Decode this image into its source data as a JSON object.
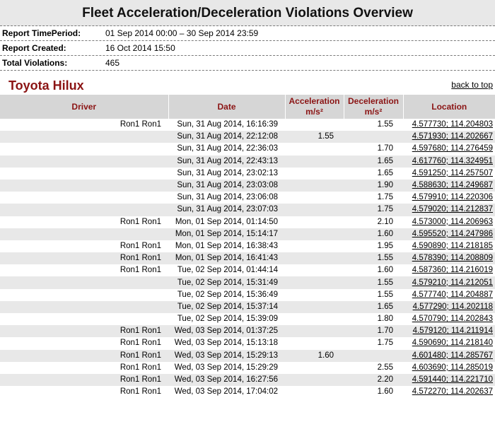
{
  "report": {
    "title": "Fleet Acceleration/Deceleration Violations Overview",
    "info": [
      {
        "label": "Report TimePeriod:",
        "value": "01 Sep 2014 00:00 – 30 Sep 2014 23:59"
      },
      {
        "label": "Report Created:",
        "value": "16 Oct 2014 15:50"
      },
      {
        "label": "Total Violations:",
        "value": "465"
      }
    ]
  },
  "vehicle": {
    "name": "Toyota Hilux",
    "back_to_top": "back to top"
  },
  "table": {
    "headers": {
      "driver": "Driver",
      "date": "Date",
      "acceleration": "Acceleration",
      "acceleration_unit": "m/s²",
      "deceleration": "Deceleration",
      "deceleration_unit": "m/s²",
      "location": "Location"
    },
    "rows": [
      {
        "driver": "Ron1 Ron1",
        "date": "Sun, 31 Aug 2014, 16:16:39",
        "acc": "",
        "dec": "1.55",
        "loc": "4.577730; 114.204803"
      },
      {
        "driver": "",
        "date": "Sun, 31 Aug 2014, 22:12:08",
        "acc": "1.55",
        "dec": "",
        "loc": "4.571930; 114.202667"
      },
      {
        "driver": "",
        "date": "Sun, 31 Aug 2014, 22:36:03",
        "acc": "",
        "dec": "1.70",
        "loc": "4.597680; 114.276459"
      },
      {
        "driver": "",
        "date": "Sun, 31 Aug 2014, 22:43:13",
        "acc": "",
        "dec": "1.65",
        "loc": "4.617760; 114.324951"
      },
      {
        "driver": "",
        "date": "Sun, 31 Aug 2014, 23:02:13",
        "acc": "",
        "dec": "1.65",
        "loc": "4.591250; 114.257507"
      },
      {
        "driver": "",
        "date": "Sun, 31 Aug 2014, 23:03:08",
        "acc": "",
        "dec": "1.90",
        "loc": "4.588630; 114.249687"
      },
      {
        "driver": "",
        "date": "Sun, 31 Aug 2014, 23:06:08",
        "acc": "",
        "dec": "1.75",
        "loc": "4.579910; 114.220306"
      },
      {
        "driver": "",
        "date": "Sun, 31 Aug 2014, 23:07:03",
        "acc": "",
        "dec": "1.75",
        "loc": "4.579020; 114.212837"
      },
      {
        "driver": "Ron1 Ron1",
        "date": "Mon, 01 Sep 2014, 01:14:50",
        "acc": "",
        "dec": "2.10",
        "loc": "4.573000; 114.206963"
      },
      {
        "driver": "",
        "date": "Mon, 01 Sep 2014, 15:14:17",
        "acc": "",
        "dec": "1.60",
        "loc": "4.595520; 114.247986"
      },
      {
        "driver": "Ron1 Ron1",
        "date": "Mon, 01 Sep 2014, 16:38:43",
        "acc": "",
        "dec": "1.95",
        "loc": "4.590890; 114.218185"
      },
      {
        "driver": "Ron1 Ron1",
        "date": "Mon, 01 Sep 2014, 16:41:43",
        "acc": "",
        "dec": "1.55",
        "loc": "4.578390; 114.208809"
      },
      {
        "driver": "Ron1 Ron1",
        "date": "Tue, 02 Sep 2014, 01:44:14",
        "acc": "",
        "dec": "1.60",
        "loc": "4.587360; 114.216019"
      },
      {
        "driver": "",
        "date": "Tue, 02 Sep 2014, 15:31:49",
        "acc": "",
        "dec": "1.55",
        "loc": "4.579210; 114.212051"
      },
      {
        "driver": "",
        "date": "Tue, 02 Sep 2014, 15:36:49",
        "acc": "",
        "dec": "1.55",
        "loc": "4.577740; 114.204887"
      },
      {
        "driver": "",
        "date": "Tue, 02 Sep 2014, 15:37:14",
        "acc": "",
        "dec": "1.65",
        "loc": "4.577290; 114.202118"
      },
      {
        "driver": "",
        "date": "Tue, 02 Sep 2014, 15:39:09",
        "acc": "",
        "dec": "1.80",
        "loc": "4.570790; 114.202843"
      },
      {
        "driver": "Ron1 Ron1",
        "date": "Wed, 03 Sep 2014, 01:37:25",
        "acc": "",
        "dec": "1.70",
        "loc": "4.579120; 114.211914"
      },
      {
        "driver": "Ron1 Ron1",
        "date": "Wed, 03 Sep 2014, 15:13:18",
        "acc": "",
        "dec": "1.75",
        "loc": "4.590690; 114.218140"
      },
      {
        "driver": "Ron1 Ron1",
        "date": "Wed, 03 Sep 2014, 15:29:13",
        "acc": "1.60",
        "dec": "",
        "loc": "4.601480; 114.285767"
      },
      {
        "driver": "Ron1 Ron1",
        "date": "Wed, 03 Sep 2014, 15:29:29",
        "acc": "",
        "dec": "2.55",
        "loc": "4.603690; 114.285019"
      },
      {
        "driver": "Ron1 Ron1",
        "date": "Wed, 03 Sep 2014, 16:27:56",
        "acc": "",
        "dec": "2.20",
        "loc": "4.591440; 114.221710"
      },
      {
        "driver": "Ron1 Ron1",
        "date": "Wed, 03 Sep 2014, 17:04:02",
        "acc": "",
        "dec": "1.60",
        "loc": "4.572270; 114.202637"
      }
    ]
  }
}
